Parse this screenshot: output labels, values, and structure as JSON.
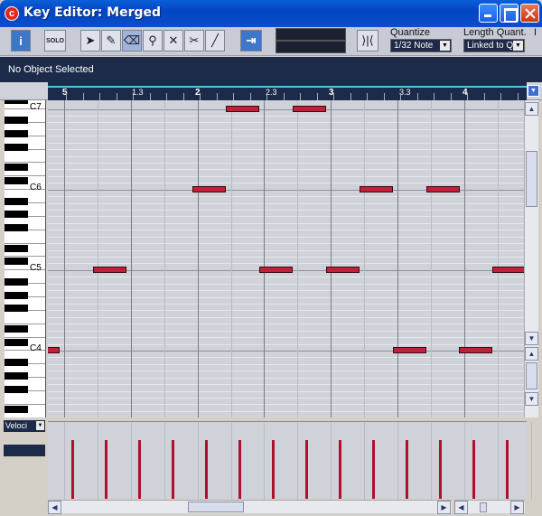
{
  "window": {
    "title": "Key Editor: Merged",
    "app_icon": "cubase-icon",
    "buttons": [
      "minimize-icon",
      "maximize-icon",
      "close-icon"
    ]
  },
  "toolbar": {
    "info_label": "i",
    "solo_label": "SOLO",
    "tools": [
      "arrow-icon",
      "pencil-icon",
      "eraser-select-icon",
      "magnifier-icon",
      "mute-x-icon",
      "split-icon",
      "line-icon"
    ],
    "autoscroll_icon": "autoscroll-icon",
    "snap_icon": "snap-icon",
    "quantize_label": "Quantize",
    "quantize_value": "1/32 Note",
    "length_label": "Length Quant.",
    "length_value": "Linked to Q",
    "extra_label": "I"
  },
  "infoline": {
    "text": "No Object Selected"
  },
  "ruler": {
    "labels": [
      "5",
      "1.3",
      "2",
      "2.3",
      "3",
      "3.3",
      "4"
    ]
  },
  "keyboard": {
    "octave_labels": [
      "C7",
      "C6",
      "C5",
      "C4"
    ]
  },
  "velocity": {
    "selector_label": "Veloci"
  },
  "colors": {
    "note": "#c0203a",
    "lane_bg": "#cfd2d8",
    "dark_panel": "#1d2b4a"
  }
}
